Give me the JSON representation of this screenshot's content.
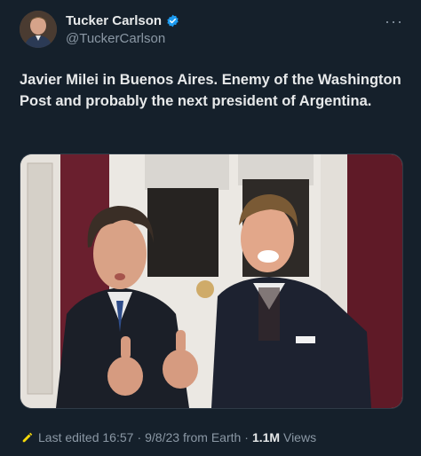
{
  "author": {
    "name": "Tucker Carlson",
    "handle": "@TuckerCarlson",
    "verified_badge_icon": "verified-badge-icon",
    "avatar_icon": "avatar"
  },
  "more_label": "···",
  "tweet": {
    "text": "Javier Milei in Buenos Aires. Enemy of the Washington Post and probably the next president of Argentina."
  },
  "footer": {
    "edit_icon": "pencil-icon",
    "last_edited_label": "Last edited",
    "time": "16:57",
    "dot1": "·",
    "date": "9/8/23",
    "source": "from Earth",
    "dot2": "·",
    "views_count": "1.1M",
    "views_label": "Views"
  },
  "colors": {
    "background": "#15202b",
    "verified": "#1d9bf0",
    "muted_text": "#8b98a5",
    "edit_icon": "#f5d90a"
  }
}
